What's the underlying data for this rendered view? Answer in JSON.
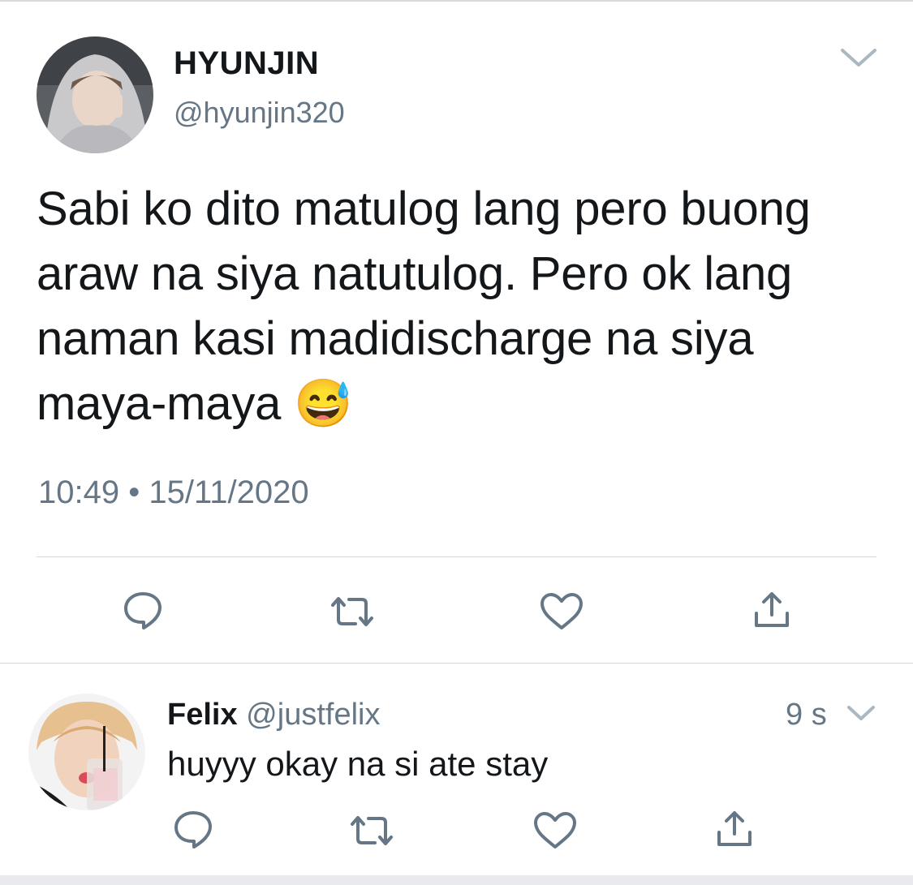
{
  "main_tweet": {
    "display_name": "HYUNJIN",
    "handle": "@hyunjin320",
    "text": "Sabi ko dito matulog lang pero buong araw na siya natutulog. Pero ok lang naman kasi madidischarge na siya maya-maya 😅",
    "time": "10:49",
    "separator": "•",
    "date": "15/11/2020",
    "actions": [
      "reply-icon",
      "retweet-icon",
      "like-icon",
      "share-icon"
    ]
  },
  "reply_tweet": {
    "display_name": "Felix",
    "handle": "@justfelix",
    "age": "9 s",
    "text": "huyyy okay na si ate stay",
    "actions": [
      "reply-icon",
      "retweet-icon",
      "like-icon",
      "share-icon"
    ]
  },
  "colors": {
    "text": "#14171a",
    "secondary": "#657786",
    "icon": "#657786",
    "divider": "#d6d9dc"
  }
}
